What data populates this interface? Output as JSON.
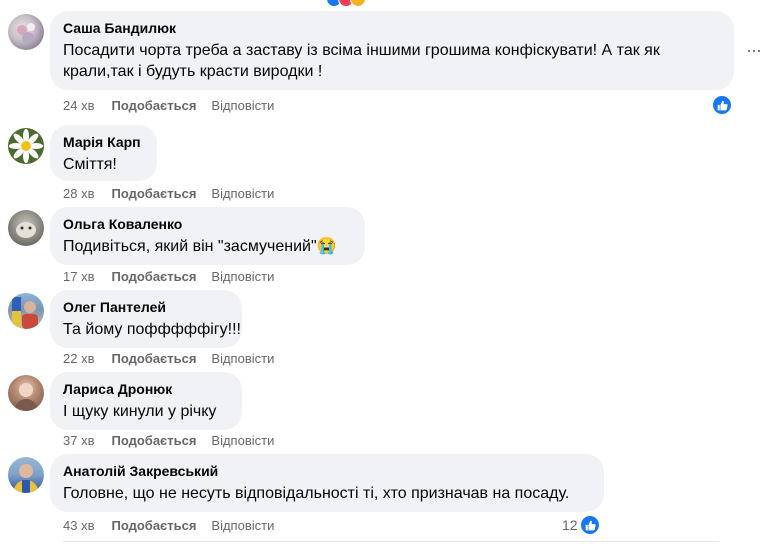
{
  "comments": [
    {
      "author": "Саша Бандилюк",
      "text_lines": [
        "Посадити чорта треба а заставу із всіма іншими грошима конфіскувати! А так як",
        "крали,так і будуть красти виродки !"
      ],
      "time": "24 хв",
      "like": "Подобається",
      "reply": "Відповісти",
      "reaction": "like-icon",
      "reaction_count": "",
      "more": "···"
    },
    {
      "author": "Марія Карп",
      "text_lines": [
        "Сміття!"
      ],
      "time": "28 хв",
      "like": "Подобається",
      "reply": "Відповісти"
    },
    {
      "author": "Ольга Коваленко",
      "text_lines": [
        "Подивіться, який він \"засмучений\"😭"
      ],
      "time": "17 хв",
      "like": "Подобається",
      "reply": "Відповісти"
    },
    {
      "author": "Олег Пантелей",
      "text_lines": [
        "Та йому пофффффігу!!!"
      ],
      "time": "22 хв",
      "like": "Подобається",
      "reply": "Відповісти"
    },
    {
      "author": "Лариса Дронюк",
      "text_lines": [
        "І щуку кинули у річку"
      ],
      "time": "37 хв",
      "like": "Подобається",
      "reply": "Відповісти"
    },
    {
      "author": "Анатолій Закревський",
      "text_lines": [
        "Головне, що не несуть відповідальності ті, хто призначав на посаду."
      ],
      "time": "43 хв",
      "like": "Подобається",
      "reply": "Відповісти",
      "reaction": "like-icon",
      "reaction_count": "12"
    }
  ],
  "colors": {
    "bubble": "#f0f2f5",
    "meta": "#65676b",
    "like_blue": "#1877f2"
  }
}
